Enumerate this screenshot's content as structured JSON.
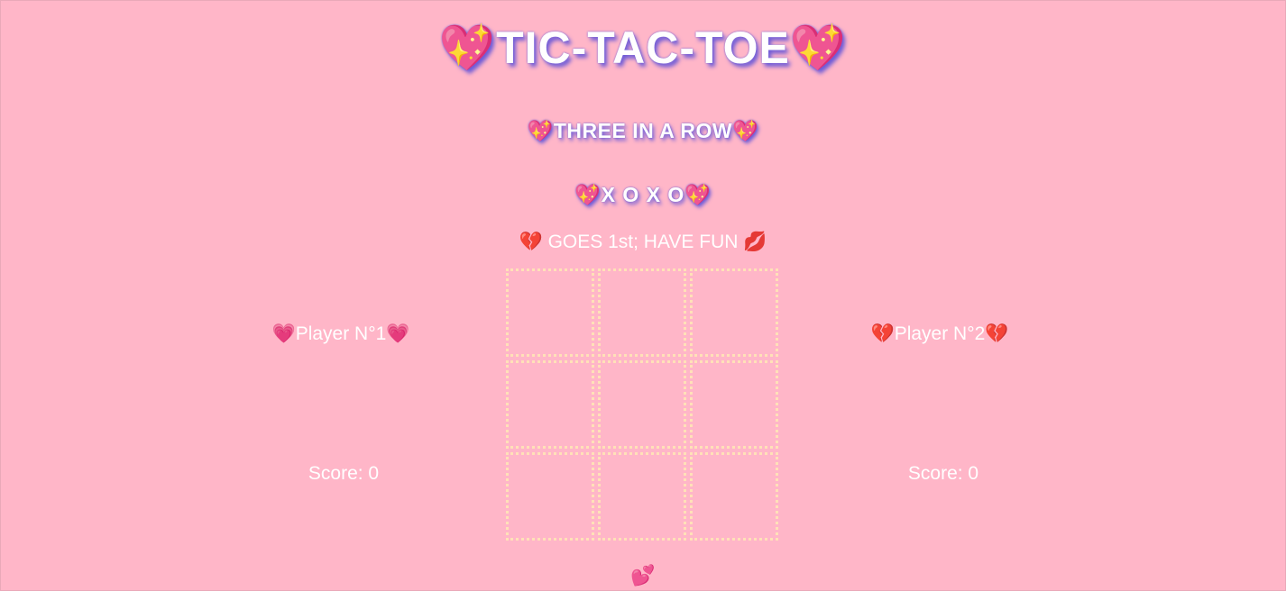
{
  "header": {
    "title": "💖TIC-TAC-TOE💖",
    "subtitle": "💖THREE IN A ROW💖",
    "xoxo": "💖X O X O💖"
  },
  "status": {
    "text": "💔 GOES 1st; HAVE FUN 💋"
  },
  "players": {
    "p1": {
      "name": "💗Player N°1💗",
      "score_label": "Score: 0"
    },
    "p2": {
      "name": "💔Player N°2💔",
      "score_label": "Score: 0"
    }
  },
  "board": {
    "cells": [
      "",
      "",
      "",
      "",
      "",
      "",
      "",
      "",
      ""
    ]
  },
  "footer": {
    "icon": "💕"
  },
  "colors": {
    "background": "#ffb6c8",
    "text": "#ffffff",
    "title_shadow": "#6d5bd8",
    "cell_border": "#ffe1b8"
  }
}
